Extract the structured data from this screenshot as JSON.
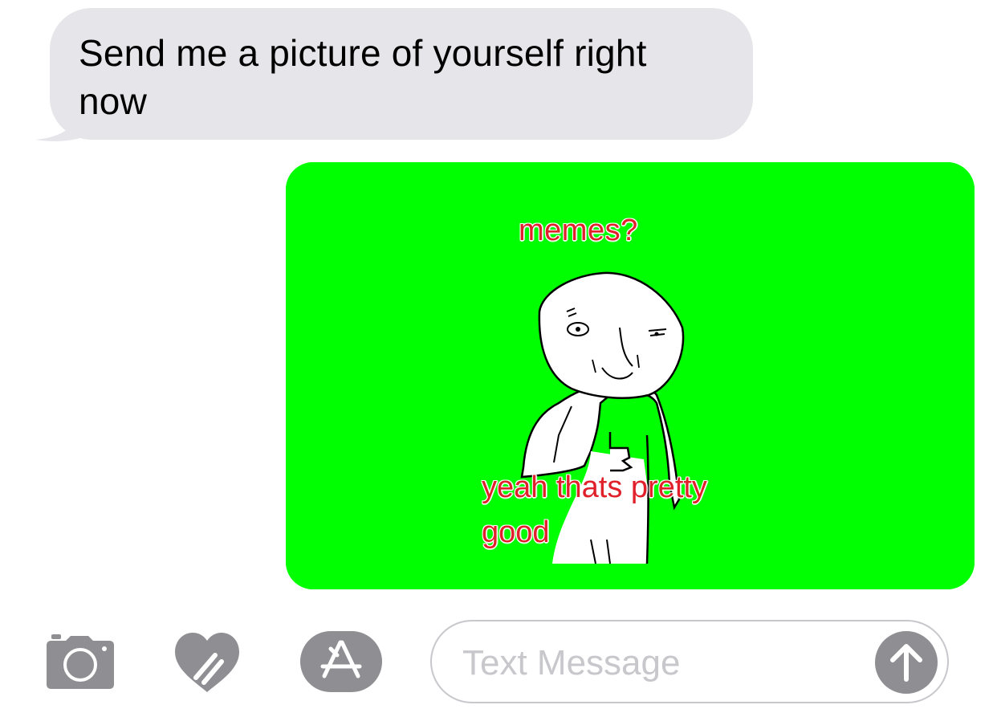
{
  "conversation": {
    "incoming_message": {
      "line1": "Send me a picture of yourself right",
      "line2": "now"
    },
    "outgoing_image": {
      "top_caption": "memes?",
      "bottom_caption_line1": "yeah thats pretty",
      "bottom_caption_line2": "good",
      "background_color": "#00ff00",
      "caption_color": "#e0202a"
    }
  },
  "composer": {
    "placeholder": "Text Message",
    "icons": [
      "camera-icon",
      "digital-touch-icon",
      "app-store-icon",
      "send-arrow-icon"
    ]
  },
  "colors": {
    "incoming_bubble": "#e5e5ea",
    "toolbar_icon": "#8e8e93",
    "field_border": "#c7c7cc"
  }
}
